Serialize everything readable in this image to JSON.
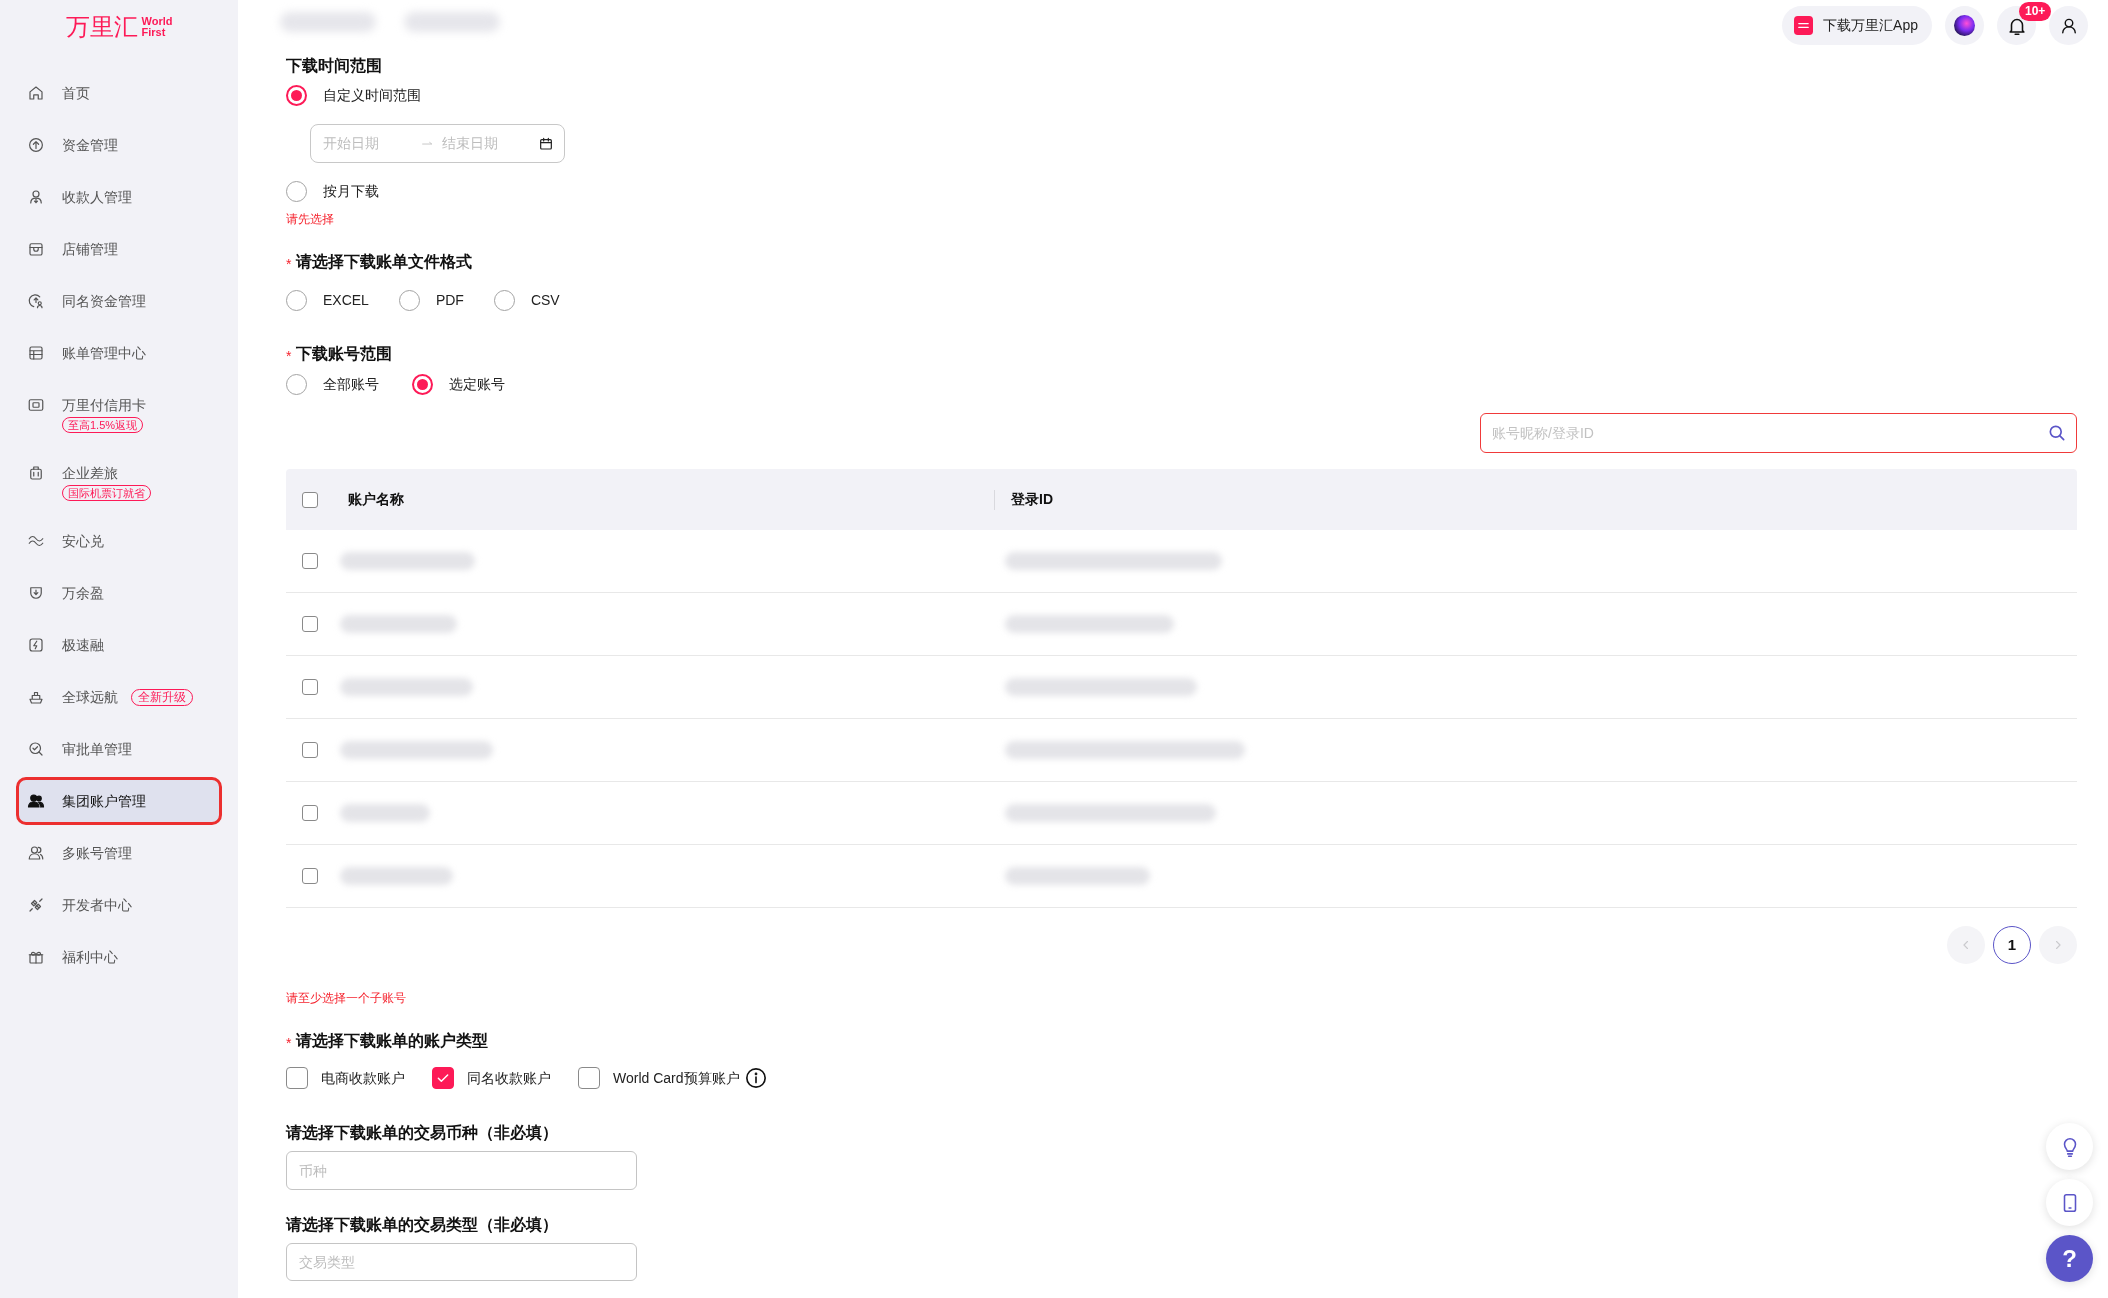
{
  "logo": {
    "text": "万里汇",
    "subtext": "World First"
  },
  "sidebar": {
    "items": [
      {
        "label": "首页",
        "selected": false,
        "kind": "plain"
      },
      {
        "label": "资金管理",
        "selected": false,
        "kind": "plain"
      },
      {
        "label": "收款人管理",
        "selected": false,
        "kind": "plain"
      },
      {
        "label": "店铺管理",
        "selected": false,
        "kind": "plain"
      },
      {
        "label": "同名资金管理",
        "selected": false,
        "kind": "plain"
      },
      {
        "label": "账单管理中心",
        "selected": false,
        "kind": "plain"
      },
      {
        "label": "万里付信用卡",
        "selected": false,
        "kind": "badge_below",
        "badge": "至高1.5%返现"
      },
      {
        "label": "企业差旅",
        "selected": false,
        "kind": "badge_below",
        "badge": "国际机票订就省"
      },
      {
        "label": "安心兑",
        "selected": false,
        "kind": "plain"
      },
      {
        "label": "万余盈",
        "selected": false,
        "kind": "plain"
      },
      {
        "label": "极速融",
        "selected": false,
        "kind": "plain"
      },
      {
        "label": "全球远航",
        "selected": false,
        "kind": "badge_inline",
        "badge": "全新升级"
      },
      {
        "label": "审批单管理",
        "selected": false,
        "kind": "plain"
      },
      {
        "label": "集团账户管理",
        "selected": true,
        "kind": "plain"
      },
      {
        "label": "多账号管理",
        "selected": false,
        "kind": "plain"
      },
      {
        "label": "开发者中心",
        "selected": false,
        "kind": "plain"
      },
      {
        "label": "福利中心",
        "selected": false,
        "kind": "plain"
      }
    ]
  },
  "top_bar": {
    "app_download": "下载万里汇App",
    "notification_badge": "10+"
  },
  "time_range": {
    "title": "下载时间范围",
    "options": [
      {
        "label": "自定义时间范围",
        "selected": true,
        "date_range": {
          "start_placeholder": "开始日期",
          "end_placeholder": "结束日期"
        }
      },
      {
        "label": "按月下载",
        "selected": false
      }
    ],
    "error": "请先选择"
  },
  "file_format": {
    "required_mark": "*",
    "title": "请选择下载账单文件格式",
    "options": [
      {
        "label": "EXCEL",
        "selected": false
      },
      {
        "label": "PDF",
        "selected": false
      },
      {
        "label": "CSV",
        "selected": false
      }
    ]
  },
  "account_range": {
    "required_mark": "*",
    "title": "下载账号范围",
    "options": [
      {
        "label": "全部账号",
        "selected": false
      },
      {
        "label": "选定账号",
        "selected": true
      }
    ]
  },
  "search": {
    "placeholder": "账号昵称/登录ID"
  },
  "table": {
    "select_all_checked": false,
    "columns": [
      "账户名称",
      "登录ID"
    ],
    "rows": [
      {
        "checked": false
      },
      {
        "checked": false
      },
      {
        "checked": false
      },
      {
        "checked": false
      },
      {
        "checked": false
      },
      {
        "checked": false
      }
    ]
  },
  "pagination": {
    "prev_disabled": true,
    "pages": [
      {
        "label": "1",
        "selected": true
      }
    ],
    "next_disabled": true
  },
  "account_error": "请至少选择一个子账号",
  "account_types": {
    "required_mark": "*",
    "title": "请选择下载账单的账户类型",
    "options": [
      {
        "label": "电商收款账户",
        "checked": false
      },
      {
        "label": "同名收款账户",
        "checked": true
      },
      {
        "label": "World Card预算账户",
        "checked": false,
        "info": true
      }
    ]
  },
  "currency": {
    "label": "请选择下载账单的交易币种（非必填）",
    "placeholder": "币种"
  },
  "transaction_type": {
    "label": "请选择下载账单的交易类型（非必填）",
    "placeholder": "交易类型"
  },
  "help_button": "?"
}
